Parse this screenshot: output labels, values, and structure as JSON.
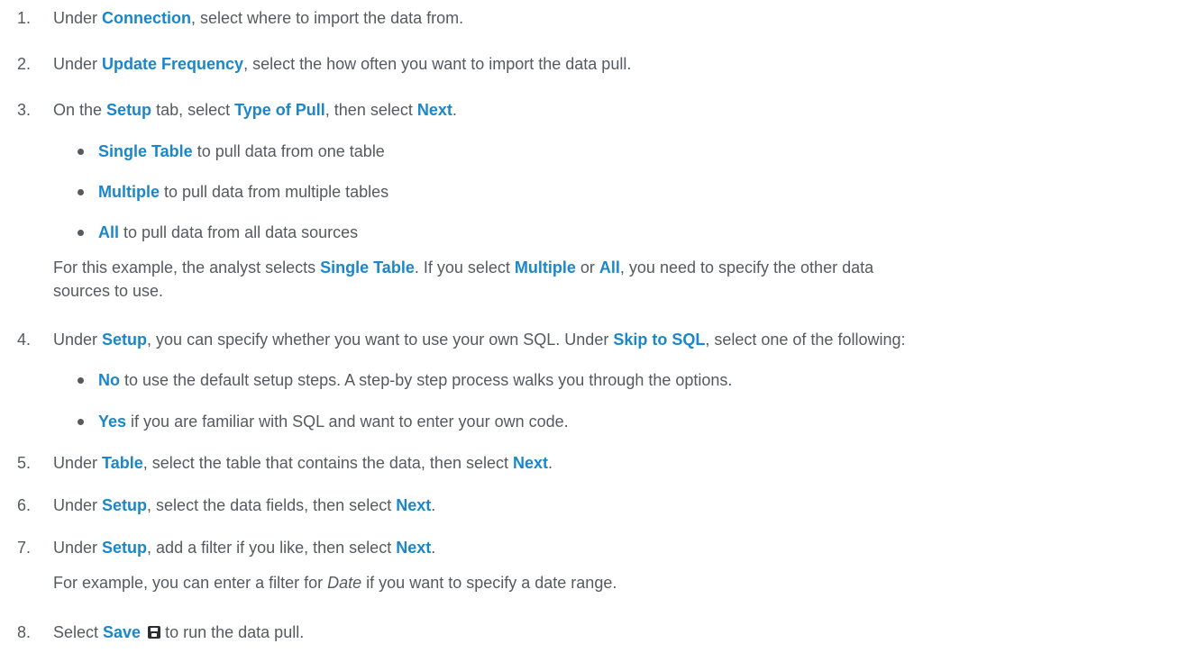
{
  "steps": [
    {
      "num": "1.",
      "pre": "Under ",
      "kw1": "Connection",
      "post": ", select where to import the data from."
    },
    {
      "num": "2.",
      "pre": "Under ",
      "kw1": "Update Frequency",
      "post": ", select the how often you want to import the data pull."
    },
    {
      "num": "3.",
      "pre": "On the ",
      "kw1": "Setup",
      "mid1": " tab, select ",
      "kw2": "Type of Pull",
      "mid2": ", then select ",
      "kw3": "Next",
      "post": ".",
      "bullets": [
        {
          "kw": "Single Table",
          "text": " to pull data from one table"
        },
        {
          "kw": "Multiple",
          "text": " to pull data from multiple tables"
        },
        {
          "kw": "All",
          "text": " to pull data from all data sources"
        }
      ],
      "note": {
        "pre": "For this example, the analyst selects ",
        "kw1": "Single Table",
        "mid1": ". If you select ",
        "kw2": "Multiple",
        "mid2": " or ",
        "kw3": "All",
        "post": ", you need to specify the other data",
        "line2": "sources to use."
      }
    },
    {
      "num": "4.",
      "pre": "Under ",
      "kw1": "Setup",
      "mid1": ", you can specify whether you want to use your own SQL. Under ",
      "kw2": "Skip to SQL",
      "post": ", select one of the following:",
      "bullets": [
        {
          "kw": "No",
          "text": " to use the default setup steps. A step-by step process walks you through the options."
        },
        {
          "kw": "Yes",
          "text": " if you are familiar with SQL and want to enter your own code."
        }
      ]
    },
    {
      "num": "5.",
      "pre": "Under ",
      "kw1": "Table",
      "mid1": ", select the table that contains the data, then select ",
      "kw2": "Next",
      "post": "."
    },
    {
      "num": "6.",
      "pre": "Under ",
      "kw1": "Setup",
      "mid1": ", select the data fields, then select ",
      "kw2": "Next",
      "post": "."
    },
    {
      "num": "7.",
      "pre": "Under ",
      "kw1": "Setup",
      "mid1": ", add a filter if you like, then select ",
      "kw2": "Next",
      "post": ".",
      "note": {
        "pre": "For example, you can enter a filter for ",
        "em": "Date",
        "post": " if you want to specify a date range."
      }
    },
    {
      "num": "8.",
      "pre": "Select ",
      "kw1": "Save",
      "icon": "save-icon",
      "post": " to run the data pull."
    }
  ]
}
